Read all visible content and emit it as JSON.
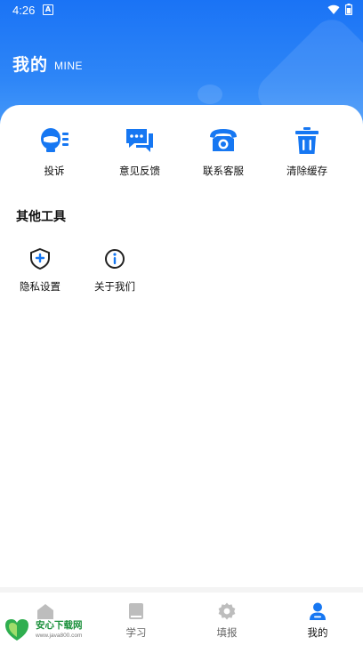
{
  "status_bar": {
    "time": "4:26",
    "notif_letter": "A"
  },
  "header": {
    "title": "我的",
    "subtitle": "MINE"
  },
  "shortcuts": [
    {
      "label": "投诉",
      "icon": "complaint-icon"
    },
    {
      "label": "意见反馈",
      "icon": "feedback-chat-icon"
    },
    {
      "label": "联系客服",
      "icon": "telephone-icon"
    },
    {
      "label": "清除缓存",
      "icon": "trash-icon"
    }
  ],
  "tools": {
    "title": "其他工具",
    "items": [
      {
        "label": "隐私设置",
        "icon": "shield-icon"
      },
      {
        "label": "关于我们",
        "icon": "info-icon"
      }
    ]
  },
  "tabbar": [
    {
      "label": "",
      "icon": "home-icon"
    },
    {
      "label": "学习",
      "icon": "book-icon"
    },
    {
      "label": "填报",
      "icon": "gear-icon"
    },
    {
      "label": "我的",
      "icon": "user-icon",
      "active": true
    }
  ],
  "watermark": {
    "name": "安心下载网",
    "url": "www.java800.com"
  },
  "colors": {
    "primary": "#1a73f5",
    "icon_blue": "#1677f2",
    "text": "#111111",
    "muted": "#666666"
  }
}
